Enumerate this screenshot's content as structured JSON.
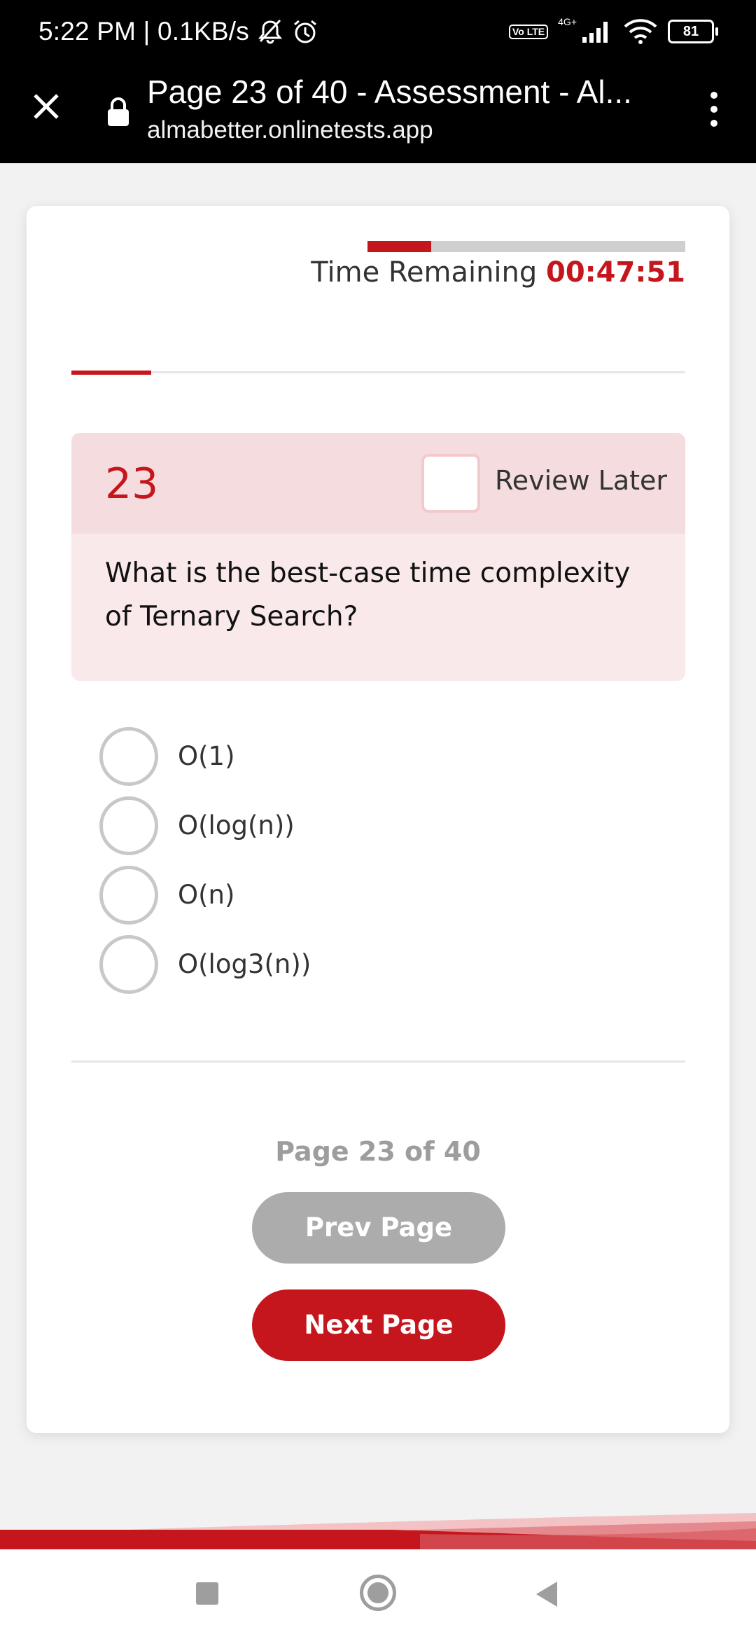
{
  "status_bar": {
    "time_speed": "5:22 PM | 0.1KB/s",
    "network_type": "4G+",
    "volte": "Vo LTE",
    "battery": "81"
  },
  "browser": {
    "page_title": "Page 23 of 40 - Assessment - Al...",
    "url": "almabetter.onlinetests.app"
  },
  "timer": {
    "label": "Time Remaining",
    "value": "00:47:51",
    "elapsed_fraction": 0.2
  },
  "section_progress_fraction": 0.13,
  "question": {
    "number": "23",
    "review_label": "Review Later",
    "review_checked": false,
    "text": "What is the best-case time complexity of Ternary Search?",
    "options": [
      "O(1)",
      "O(log(n))",
      "O(n)",
      "O(log3(n))"
    ]
  },
  "pagination": {
    "indicator": "Page 23 of 40",
    "prev_label": "Prev Page",
    "next_label": "Next Page"
  },
  "colors": {
    "accent": "#c4161c",
    "question_header_bg": "#f5dcdf",
    "question_body_bg": "#f9e9ea",
    "disabled_button": "#acacac"
  }
}
